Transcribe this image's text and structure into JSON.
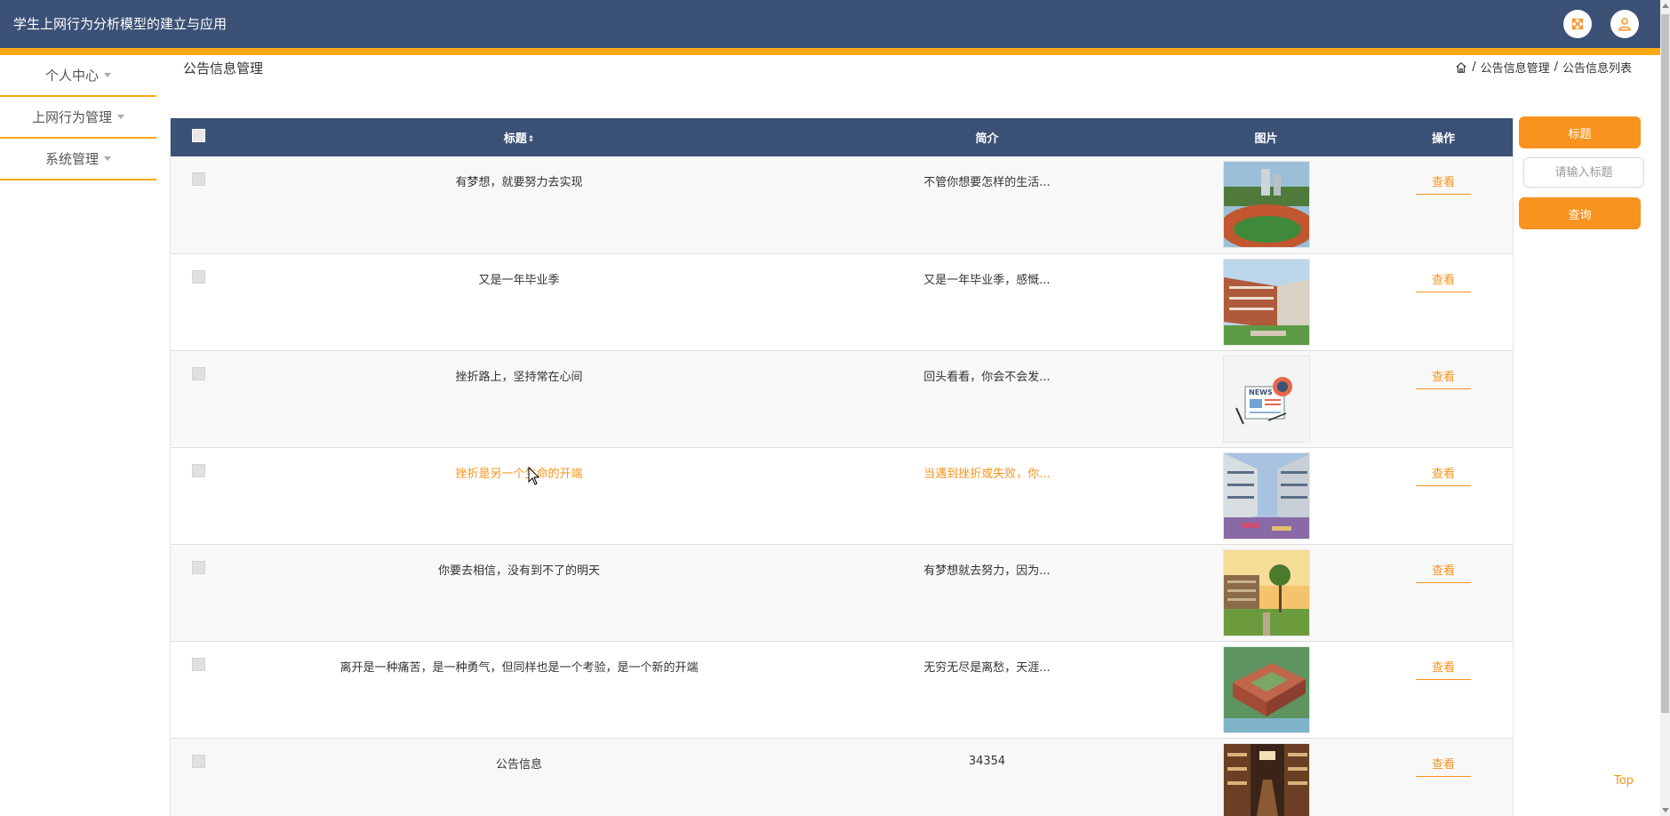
{
  "app": {
    "title": "学生上网行为分析模型的建立与应用"
  },
  "header": {
    "icons": [
      "fullscreen-icon",
      "user-icon"
    ]
  },
  "sidebar": {
    "items": [
      {
        "label": "个人中心"
      },
      {
        "label": "上网行为管理"
      },
      {
        "label": "系统管理"
      }
    ]
  },
  "page": {
    "title": "公告信息管理",
    "breadcrumb": {
      "separator": "/",
      "level1": "公告信息管理",
      "level2": "公告信息列表"
    }
  },
  "table": {
    "columns": {
      "title": "标题",
      "intro": "简介",
      "image": "图片",
      "action": "操作"
    },
    "sort_indicator": "⇕",
    "rows": [
      {
        "title": "有梦想，就要努力去实现",
        "intro": "不管你想要怎样的生活...",
        "action": "查看",
        "image": "campus-track"
      },
      {
        "title": "又是一年毕业季",
        "intro": "又是一年毕业季，感慨...",
        "action": "查看",
        "image": "campus-building"
      },
      {
        "title": "挫折路上，坚持常在心间",
        "intro": "回头看看，你会不会发...",
        "action": "查看",
        "image": "news-illustration"
      },
      {
        "title": "挫折是另一个生命的开端",
        "intro": "当遇到挫折或失败，你...",
        "action": "查看",
        "image": "campus-plaza",
        "hover": true
      },
      {
        "title": "你要去相信，没有到不了的明天",
        "intro": "有梦想就去努力，因为...",
        "action": "查看",
        "image": "campus-sunset"
      },
      {
        "title": "离开是一种痛苦，是一种勇气，但同样也是一个考验，是一个新的开端",
        "intro": "无穷无尽是离愁，天涯...",
        "action": "查看",
        "image": "campus-aerial"
      },
      {
        "title": "公告信息",
        "intro": "34354",
        "action": "查看",
        "image": "library-shelves"
      }
    ]
  },
  "search": {
    "field_label": "标题",
    "placeholder": "请输入标题",
    "value": "",
    "query_label": "查询"
  },
  "footer": {
    "top_label": "Top"
  },
  "colors": {
    "primary": "#3b5176",
    "accent": "#fdaa14",
    "action": "#f7931e"
  }
}
